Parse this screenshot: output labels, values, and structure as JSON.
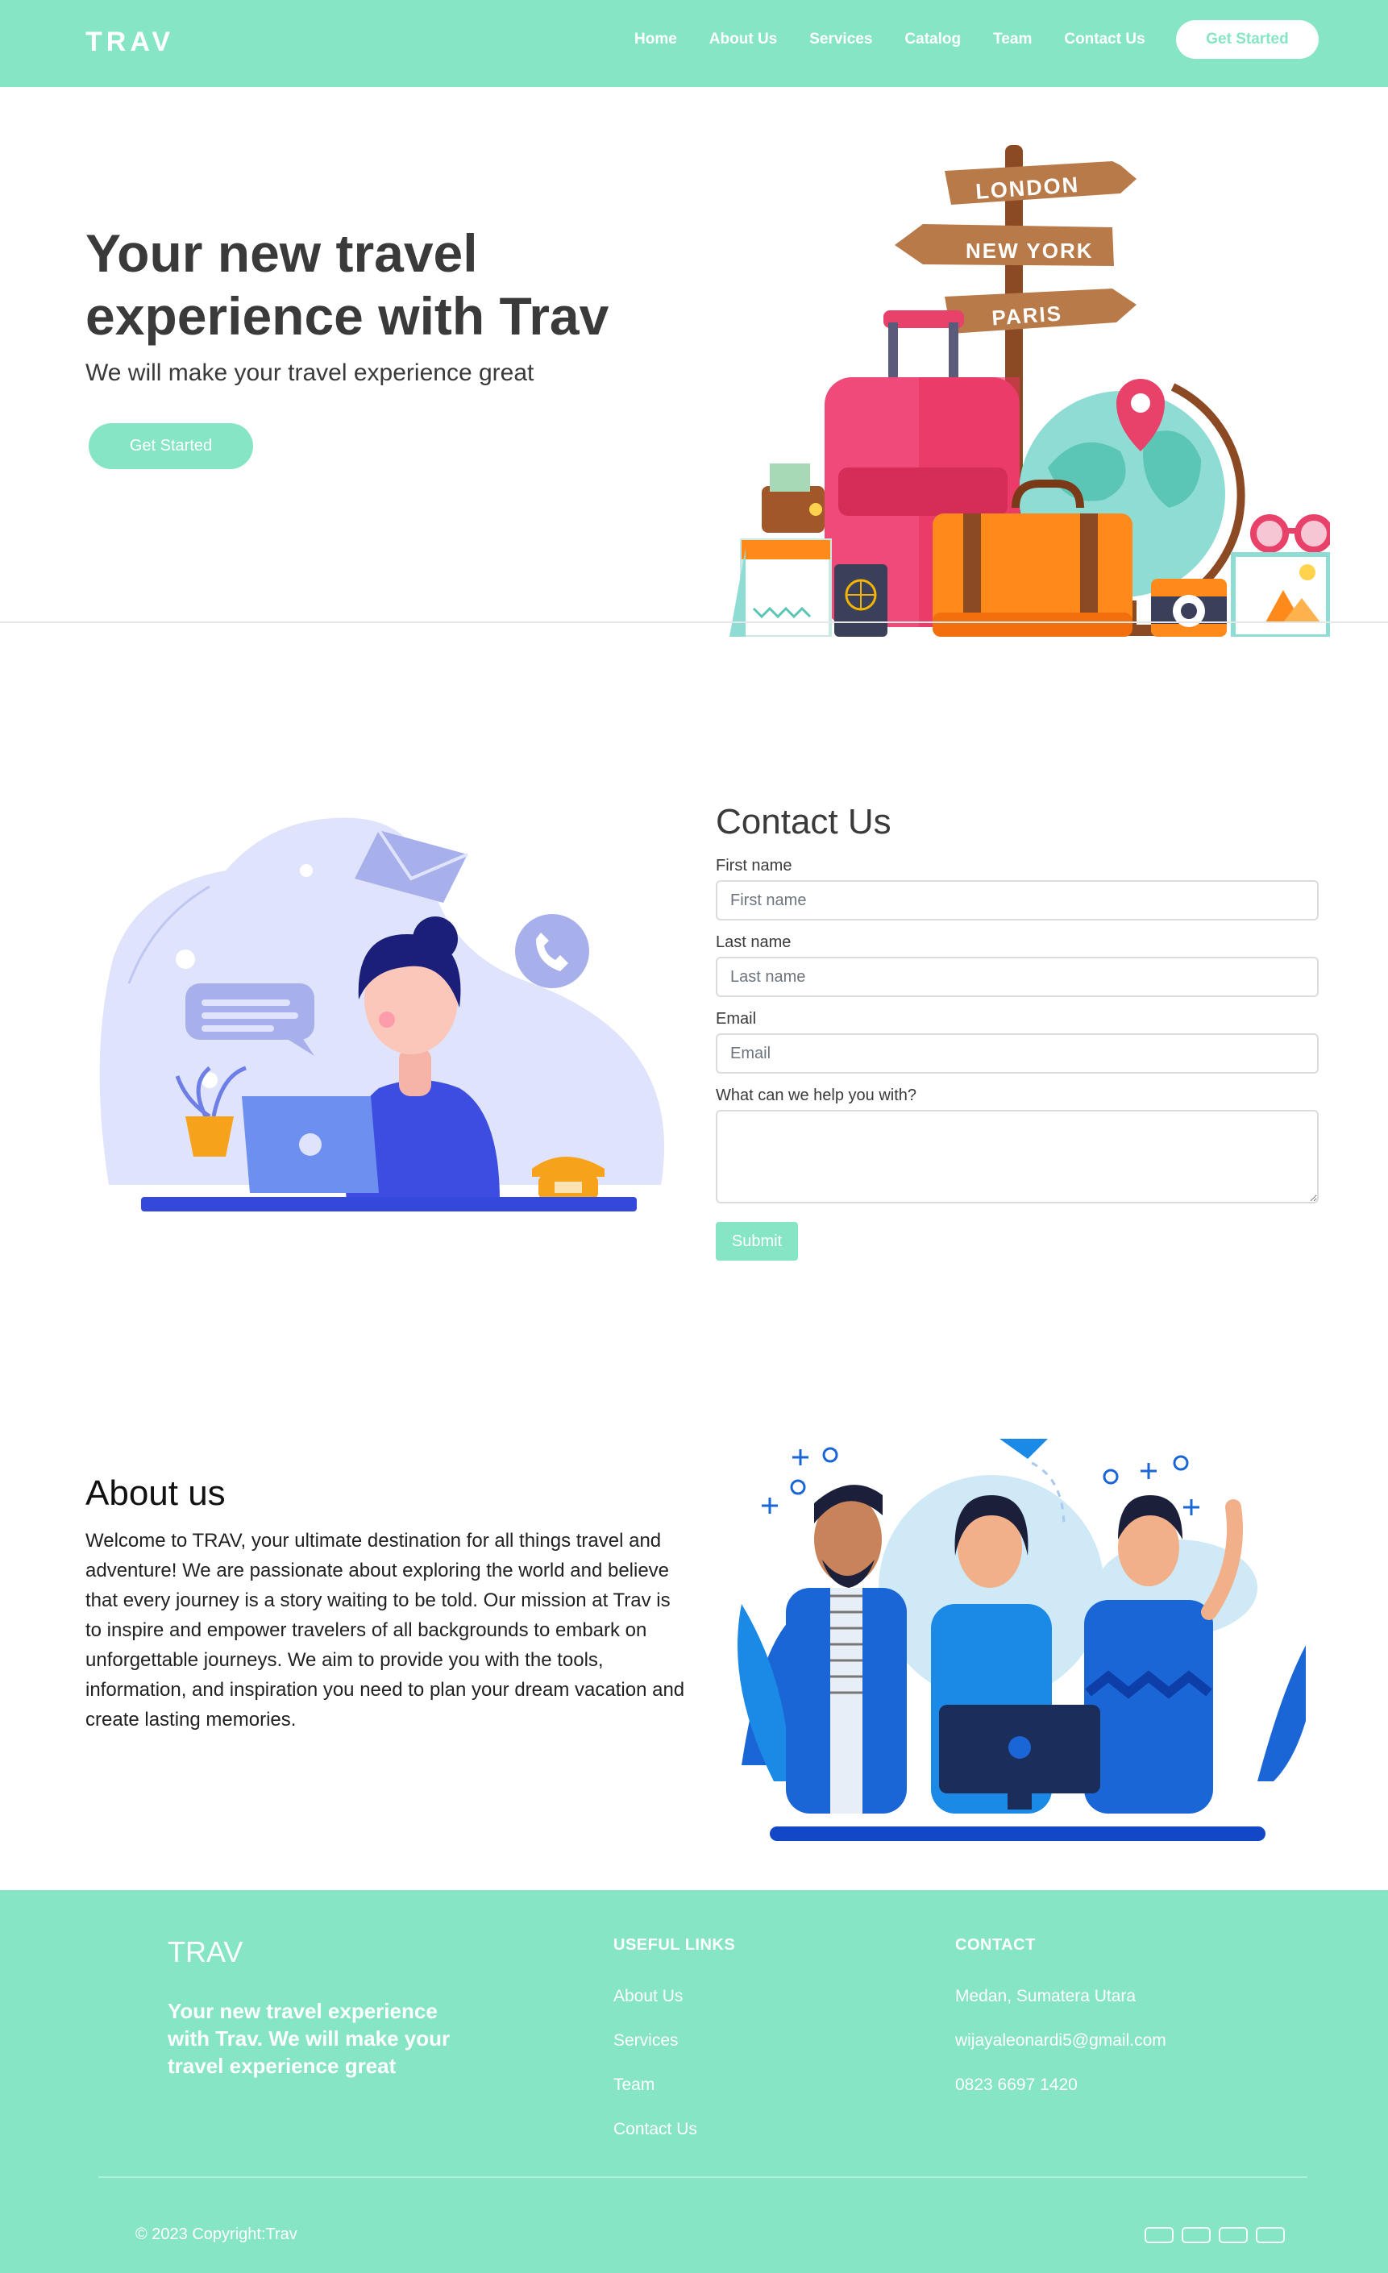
{
  "navbar": {
    "brand": "TRAV",
    "links": [
      "Home",
      "About Us",
      "Services",
      "Catalog",
      "Team",
      "Contact Us"
    ],
    "cta_label": "Get Started"
  },
  "hero": {
    "title": "Your new travel experience with Trav",
    "subtitle": "We will make your travel experience great",
    "button_label": "Get Started",
    "signposts": [
      "LONDON",
      "NEW YORK",
      "PARIS"
    ]
  },
  "contact": {
    "title": "Contact Us",
    "first_name_label": "First name",
    "first_name_placeholder": "First name",
    "last_name_label": "Last name",
    "last_name_placeholder": "Last name",
    "email_label": "Email",
    "email_placeholder": "Email",
    "message_label": "What can we help you with?",
    "submit_label": "Submit"
  },
  "about": {
    "title": "About us",
    "text": "Welcome to TRAV, your ultimate destination for all things travel and adventure! We are passionate about exploring the world and believe that every journey is a story waiting to be told. Our mission at Trav is to inspire and empower travelers of all backgrounds to embark on unforgettable journeys. We aim to provide you with the tools, information, and inspiration you need to plan your dream vacation and create lasting memories."
  },
  "footer": {
    "brand": "TRAV",
    "tagline": "Your new travel experience with Trav. We will make your travel experience great",
    "useful_links_heading": "USEFUL LINKS",
    "useful_links": [
      "About Us",
      "Services",
      "Team",
      "Contact Us"
    ],
    "contact_heading": "CONTACT",
    "contact_items": [
      "Medan, Sumatera Utara",
      "wijayaleonardi5@gmail.com",
      "0823 6697 1420"
    ],
    "copyright": "© 2023 Copyright:Trav"
  },
  "colors": {
    "accent": "#86e5c5",
    "text_dark": "#3a3a3a",
    "white": "#ffffff"
  }
}
